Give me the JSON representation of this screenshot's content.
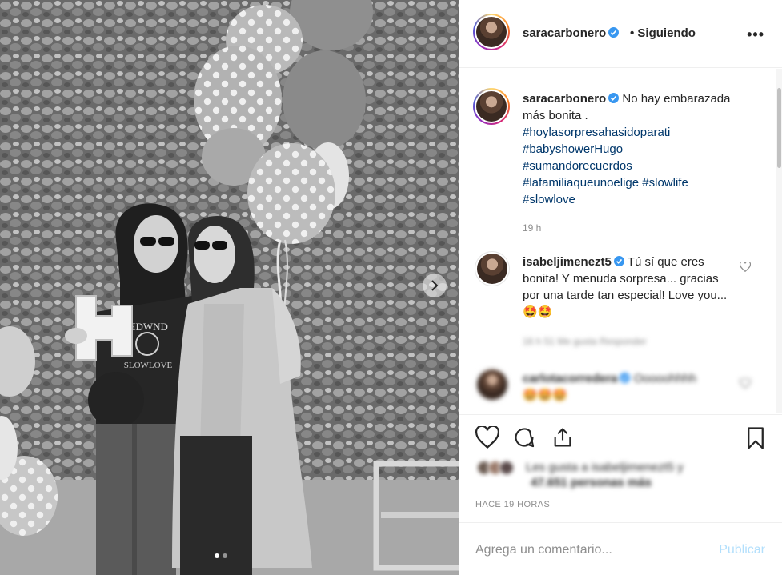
{
  "post": {
    "image": {
      "description_icon": "photo-icon",
      "carousel_dots": 2,
      "active_dot": 1
    }
  },
  "header": {
    "username": "saracarbonero",
    "follow_state": "• Siguiendo",
    "more_label": "•••"
  },
  "caption": {
    "username": "saracarbonero",
    "text": "No hay embarazada más bonita .",
    "hashtags": [
      "#hoylasorpresahasidoparati",
      "#babyshowerHugo",
      "#sumandorecuerdos",
      "#lafamiliaqueunoelige",
      "#slowlife",
      "#slowlove"
    ],
    "time": "19 h"
  },
  "comments": [
    {
      "username": "isabeljimenezt5",
      "text": "Tú sí que eres bonita! Y menuda sorpresa... gracias por una tarde tan especial! Love you... 🤩🤩",
      "meta": "16 h   51 Me gusta   Responder"
    },
    {
      "username": "carlotacorredera",
      "text": "Ooooohhhh",
      "emoji": "🤩🤩🤩"
    }
  ],
  "likes": {
    "line1": "Les gusta a isabeljimenezt5 y",
    "line2": "47.651 personas más"
  },
  "timestamp": "HACE 19 HORAS",
  "comment_box": {
    "placeholder": "Agrega un comentario...",
    "publish": "Publicar"
  },
  "colors": {
    "verified": "#3897f0",
    "hashtag": "#00376b",
    "publish_disabled": "#b2dffc",
    "meta": "#8e8e8e"
  }
}
